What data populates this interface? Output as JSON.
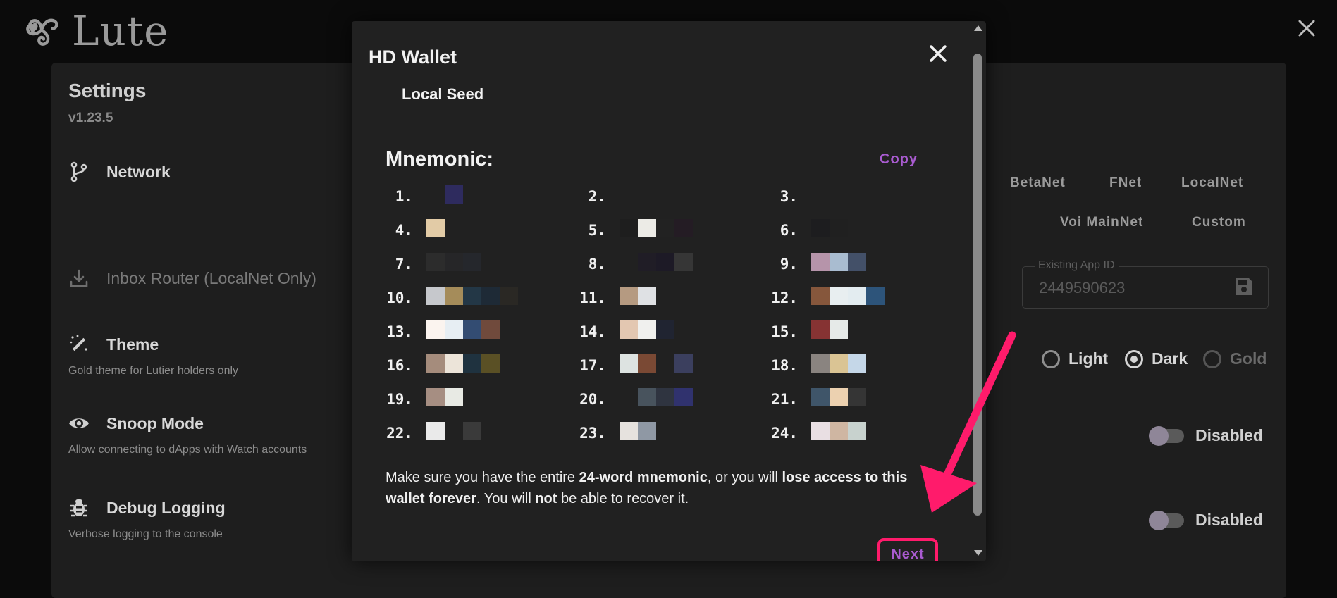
{
  "app": {
    "name": "Lute"
  },
  "settings": {
    "title": "Settings",
    "version": "v1.23.5",
    "rows": [
      {
        "label": "Network",
        "sub": ""
      },
      {
        "label": "Inbox Router (LocalNet Only)",
        "sub": ""
      },
      {
        "label": "Theme",
        "sub": "Gold theme for Lutier holders only"
      },
      {
        "label": "Snoop Mode",
        "sub": "Allow connecting to dApps with Watch accounts"
      },
      {
        "label": "Debug Logging",
        "sub": "Verbose logging to the console"
      }
    ],
    "networks": [
      "BetaNet",
      "FNet",
      "LocalNet",
      "Voi MainNet",
      "Custom"
    ],
    "existing_app_id": {
      "legend": "Existing App ID",
      "value": "2449590623"
    },
    "theme_options": [
      {
        "label": "Light",
        "selected": false
      },
      {
        "label": "Dark",
        "selected": true
      },
      {
        "label": "Gold",
        "selected": false
      }
    ],
    "snoop_mode_status": "Disabled",
    "debug_logging_status": "Disabled"
  },
  "modal": {
    "title": "HD Wallet",
    "subtitle": "Local Seed",
    "mnemonic_label": "Mnemonic:",
    "copy_label": "Copy",
    "words": [
      {
        "num": "1.",
        "colors": [
          "transparent",
          "#2e2b5e"
        ]
      },
      {
        "num": "2.",
        "colors": []
      },
      {
        "num": "3.",
        "colors": []
      },
      {
        "num": "4.",
        "colors": [
          "#e2cba6"
        ]
      },
      {
        "num": "5.",
        "colors": [
          "#1e1e1e",
          "#ecebe6",
          "#222",
          "#241c24"
        ]
      },
      {
        "num": "6.",
        "colors": [
          "#1d1d1f",
          "#202020"
        ]
      },
      {
        "num": "7.",
        "colors": [
          "#2c2c2c",
          "#262628",
          "#25272c"
        ]
      },
      {
        "num": "8.",
        "colors": [
          "#212121",
          "#201d26",
          "#1d1a26",
          "#363636"
        ]
      },
      {
        "num": "9.",
        "colors": [
          "#b694aa",
          "#a9bcd0",
          "#435068"
        ]
      },
      {
        "num": "10.",
        "colors": [
          "#c6c8cc",
          "#a58c5a",
          "#233746",
          "#1e2a36",
          "#2a2824"
        ]
      },
      {
        "num": "11.",
        "colors": [
          "#b59a81",
          "#dfe1e4"
        ]
      },
      {
        "num": "12.",
        "colors": [
          "#86573c",
          "#e8eef0",
          "#e3ecf0",
          "#2d547a"
        ]
      },
      {
        "num": "13.",
        "colors": [
          "#fbf4ef",
          "#e7eef3",
          "#334c72",
          "#704a3c"
        ]
      },
      {
        "num": "14.",
        "colors": [
          "#e3c7b1",
          "#f0f0ee",
          "#202431"
        ]
      },
      {
        "num": "15.",
        "colors": [
          "#863333",
          "#e6eae8"
        ]
      },
      {
        "num": "16.",
        "colors": [
          "#a58c7c",
          "#ece4d9",
          "#1f323f",
          "#5a5025"
        ]
      },
      {
        "num": "17.",
        "colors": [
          "#dde3e1",
          "#7a4934",
          "#212121",
          "#3b3f5e"
        ]
      },
      {
        "num": "18.",
        "colors": [
          "#8a8480",
          "#dac494",
          "#c5d7e8"
        ]
      },
      {
        "num": "19.",
        "colors": [
          "#a68e82",
          "#e8eae4"
        ]
      },
      {
        "num": "20.",
        "colors": [
          "#212121",
          "#48535d",
          "#2f3440",
          "#30326e"
        ]
      },
      {
        "num": "21.",
        "colors": [
          "#3f5569",
          "#ecd1b0",
          "#353535"
        ]
      },
      {
        "num": "22.",
        "colors": [
          "#eaeaea",
          "#212121",
          "#3a3a3a"
        ]
      },
      {
        "num": "23.",
        "colors": [
          "#e6e2de",
          "#8f98a4"
        ]
      },
      {
        "num": "24.",
        "colors": [
          "#e9dfe3",
          "#cfb6a2",
          "#c8d2ce"
        ]
      }
    ],
    "warning": {
      "p1": "Make sure you have the entire ",
      "b1": "24-word mnemonic",
      "p2": ", or you will ",
      "b2": "lose access to this wallet forever",
      "p3": ". You will ",
      "b3": "not",
      "p4": " be able to recover it."
    },
    "next_label": "Next"
  },
  "colors": {
    "accent": "#a95bd0",
    "highlight": "#ff1b6b",
    "modal_bg": "#212121",
    "card_bg": "#1e1e1e"
  }
}
